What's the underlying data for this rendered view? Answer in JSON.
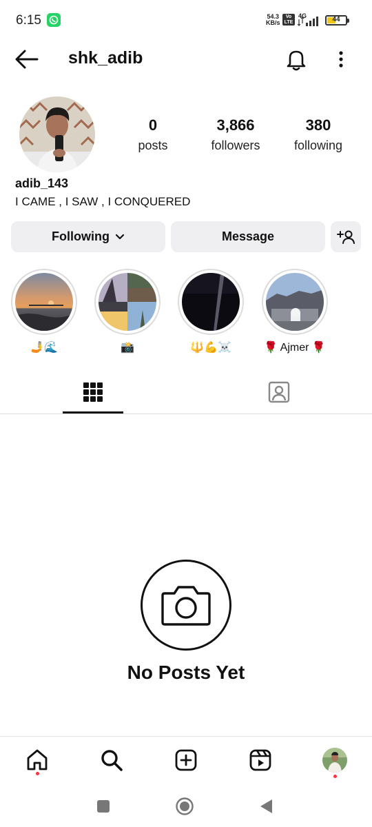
{
  "status_bar": {
    "time": "6:15",
    "net_speed_value": "54.3",
    "net_speed_unit": "KB/s",
    "volte_top": "Vo",
    "volte_bottom": "LTE",
    "network": "4G",
    "battery": "44",
    "battery_level": 0.44,
    "icons": [
      "whatsapp-icon",
      "signal-icon",
      "battery-icon"
    ]
  },
  "header": {
    "username": "shk_adib",
    "icons": [
      "back-arrow-icon",
      "bell-icon",
      "more-vertical-icon"
    ]
  },
  "profile": {
    "stats": [
      {
        "value": "0",
        "label": "posts"
      },
      {
        "value": "3,866",
        "label": "followers"
      },
      {
        "value": "380",
        "label": "following"
      }
    ],
    "name": "adib_143",
    "bio": "I CAME ,  I SAW ,  I CONQUERED"
  },
  "actions": {
    "following_label": "Following",
    "message_label": "Message",
    "icons": [
      "chevron-down-icon",
      "add-user-icon"
    ]
  },
  "highlights": [
    {
      "label": "🤳🌊"
    },
    {
      "label": "📸"
    },
    {
      "label": "🔱💪☠️"
    },
    {
      "label": "🌹 Ajmer 🌹"
    }
  ],
  "tabs": [
    "grid-icon",
    "tagged-icon"
  ],
  "empty_state": {
    "title": "No Posts Yet",
    "icon": "camera-icon"
  },
  "bottom_nav": [
    "home-icon",
    "search-icon",
    "create-icon",
    "reels-icon",
    "profile-avatar"
  ],
  "colors": {
    "button_bg": "#efeff1",
    "notification_dot": "#ff3040",
    "whatsapp": "#25d366",
    "battery": "#f5c518"
  }
}
